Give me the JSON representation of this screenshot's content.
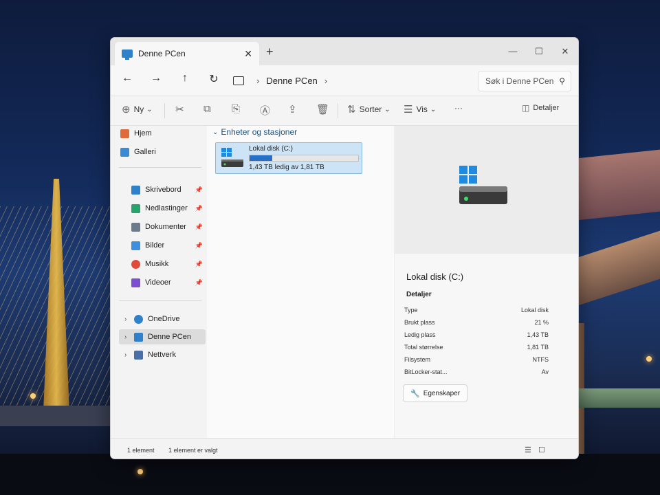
{
  "window": {
    "tab_title": "Denne PCen",
    "tab_close": "✕",
    "new_tab": "+",
    "minimize": "—",
    "maximize": "☐",
    "close": "✕"
  },
  "nav": {
    "back": "←",
    "forward": "→",
    "up": "↑",
    "refresh": "↻",
    "breadcrumb": "Denne PCen",
    "crumb_chevron_1": "›",
    "crumb_chevron_2": "›",
    "search_placeholder": "Søk i Denne PCen",
    "search_icon": "⚲"
  },
  "toolbar": {
    "new_icon": "⊕",
    "new_label": "Ny",
    "new_chevron": "⌄",
    "cut_icon": "✂",
    "copy_icon": "⧉",
    "paste_icon": "⎘",
    "rename_icon": "Ⓐ",
    "share_icon": "⇪",
    "delete_icon": "🗑",
    "sort_icon": "⇅",
    "sort_label": "Sorter",
    "sort_chevron": "⌄",
    "view_icon": "☰",
    "view_label": "Vis",
    "view_chevron": "⌄",
    "more_label": "···",
    "details_icon": "◫",
    "details_label": "Detaljer"
  },
  "sidebar": {
    "items": [
      {
        "label": "Hjem",
        "icon": "home-icon"
      },
      {
        "label": "Galleri",
        "icon": "gallery-icon"
      },
      {
        "label": "Skrivebord",
        "icon": "desktop-icon",
        "pinned": true
      },
      {
        "label": "Nedlastinger",
        "icon": "downloads-icon",
        "pinned": true
      },
      {
        "label": "Dokumenter",
        "icon": "documents-icon",
        "pinned": true
      },
      {
        "label": "Bilder",
        "icon": "pictures-icon",
        "pinned": true
      },
      {
        "label": "Musikk",
        "icon": "music-icon",
        "pinned": true
      },
      {
        "label": "Videoer",
        "icon": "videos-icon",
        "pinned": true
      },
      {
        "label": "OneDrive",
        "icon": "onedrive-icon"
      },
      {
        "label": "Denne PCen",
        "icon": "this-pc-icon",
        "selected": true
      },
      {
        "label": "Nettverk",
        "icon": "network-icon"
      }
    ],
    "pin_glyph": "📌",
    "expand_glyph": "›"
  },
  "content": {
    "group_chevron": "⌄",
    "group_title": "Enheter og stasjoner",
    "drive": {
      "name": "Lokal disk (C:)",
      "free_text": "1,43 TB ledig av 1,81 TB",
      "used_fraction": 0.21
    }
  },
  "details": {
    "title": "Lokal disk (C:)",
    "section": "Detaljer",
    "props": [
      {
        "key": "Type",
        "value": "Lokal disk"
      },
      {
        "key": "Brukt plass",
        "value": "21 %"
      },
      {
        "key": "Ledig plass",
        "value": "1,43 TB"
      },
      {
        "key": "Total størrelse",
        "value": "1,81 TB"
      },
      {
        "key": "Filsystem",
        "value": "NTFS"
      },
      {
        "key": "BitLocker-stat...",
        "value": "Av"
      }
    ],
    "properties_icon": "🔧",
    "properties_label": "Egenskaper"
  },
  "status": {
    "count": "1 element",
    "selected": "1 element er valgt",
    "details_view_icon": "☰",
    "tiles_view_icon": "☐"
  },
  "colors": {
    "accent": "#2671c7",
    "selection": "#cde4f7",
    "windows_logo": "#1f8be0"
  }
}
